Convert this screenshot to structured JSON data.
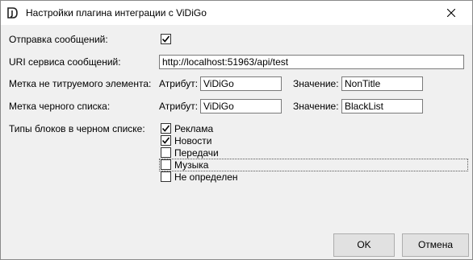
{
  "window": {
    "title": "Настройки плагина интеграции с ViDiGo",
    "icon": "app-logo-icon",
    "close_icon": "close-icon"
  },
  "form": {
    "send_messages": {
      "label": "Отправка сообщений:",
      "checked": true
    },
    "uri": {
      "label": "URI сервиса сообщений:",
      "value": "http://localhost:51963/api/test"
    },
    "non_title_mark": {
      "label": "Метка не титруемого элемента:",
      "attr_label": "Атрибут:",
      "attr_value": "ViDiGo",
      "val_label": "Значение:",
      "val_value": "NonTitle"
    },
    "blacklist_mark": {
      "label": "Метка черного списка:",
      "attr_label": "Атрибут:",
      "attr_value": "ViDiGo",
      "val_label": "Значение:",
      "val_value": "BlackList"
    },
    "block_types": {
      "label": "Типы блоков в черном списке:",
      "items": [
        {
          "label": "Реклама",
          "checked": true
        },
        {
          "label": "Новости",
          "checked": true
        },
        {
          "label": "Передачи",
          "checked": false
        },
        {
          "label": "Музыка",
          "checked": false,
          "focused": true
        },
        {
          "label": "Не определен",
          "checked": false
        }
      ]
    }
  },
  "buttons": {
    "ok": "OK",
    "cancel": "Отмена"
  }
}
